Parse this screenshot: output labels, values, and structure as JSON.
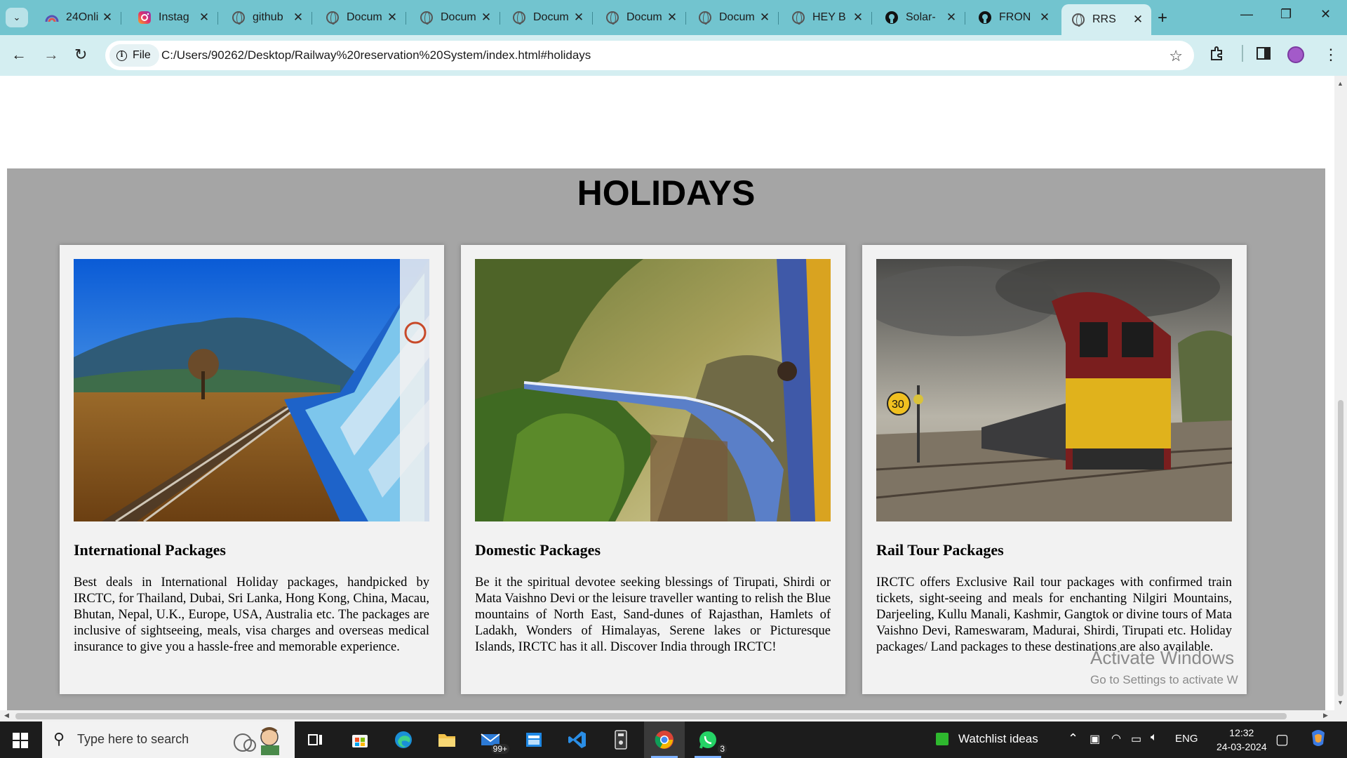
{
  "browser": {
    "tabs": [
      {
        "label": "24Onli",
        "favicon": "profile-arc-icon"
      },
      {
        "label": "Instag",
        "favicon": "instagram-icon"
      },
      {
        "label": "github",
        "favicon": "globe-icon"
      },
      {
        "label": "Docum",
        "favicon": "globe-icon"
      },
      {
        "label": "Docum",
        "favicon": "globe-icon"
      },
      {
        "label": "Docum",
        "favicon": "globe-icon"
      },
      {
        "label": "Docum",
        "favicon": "globe-icon"
      },
      {
        "label": "Docum",
        "favicon": "globe-icon"
      },
      {
        "label": "HEY B",
        "favicon": "globe-icon"
      },
      {
        "label": "Solar-",
        "favicon": "github-icon"
      },
      {
        "label": "FRON",
        "favicon": "github-icon"
      },
      {
        "label": "RRS",
        "favicon": "globe-icon",
        "active": true
      }
    ],
    "address": {
      "chip_label": "File",
      "url": "C:/Users/90262/Desktop/Railway%20reservation%20System/index.html#holidays"
    },
    "colors": {
      "tabstrip": "#72c4cf",
      "toolbar": "#d4eef1"
    }
  },
  "page": {
    "section_title": "HOLIDAYS",
    "cards": [
      {
        "title": "International Packages",
        "text": "Best deals in International Holiday packages, handpicked by IRCTC, for Thailand, Dubai, Sri Lanka, Hong Kong, China, Macau, Bhutan, Nepal, U.K., Europe, USA, Australia etc. The packages are inclusive of sightseeing, meals, visa charges and overseas medical insurance to give you a hassle-free and memorable experience."
      },
      {
        "title": "Domestic Packages",
        "text": "Be it the spiritual devotee seeking blessings of Tirupati, Shirdi or Mata Vaishno Devi or the leisure traveller wanting to relish the Blue mountains of North East, Sand-dunes of Rajasthan, Hamlets of Ladakh, Wonders of Himalayas, Serene lakes or Picturesque Islands, IRCTC has it all. Discover India through IRCTC!"
      },
      {
        "title": "Rail Tour Packages",
        "text": "IRCTC offers Exclusive Rail tour packages with confirmed train tickets, sight-seeing and meals for enchanting Nilgiri Mountains, Darjeeling, Kullu Manali, Kashmir, Gangtok or divine tours of Mata Vaishno Devi, Rameswaram, Madurai, Shirdi, Tirupati etc. Holiday packages/ Land packages to these destinations are also available."
      }
    ],
    "watermark": {
      "line1": "Activate Windows",
      "line2": "Go to Settings to activate W"
    },
    "colors": {
      "section_bg": "#a5a5a5",
      "card_bg": "#f2f2f2"
    }
  },
  "taskbar": {
    "search_placeholder": "Type here to search",
    "mail_badge": "99+",
    "whatsapp_badge": "3",
    "widget_label": "Watchlist ideas",
    "language": "ENG",
    "time": "12:32",
    "date": "24-03-2024"
  }
}
